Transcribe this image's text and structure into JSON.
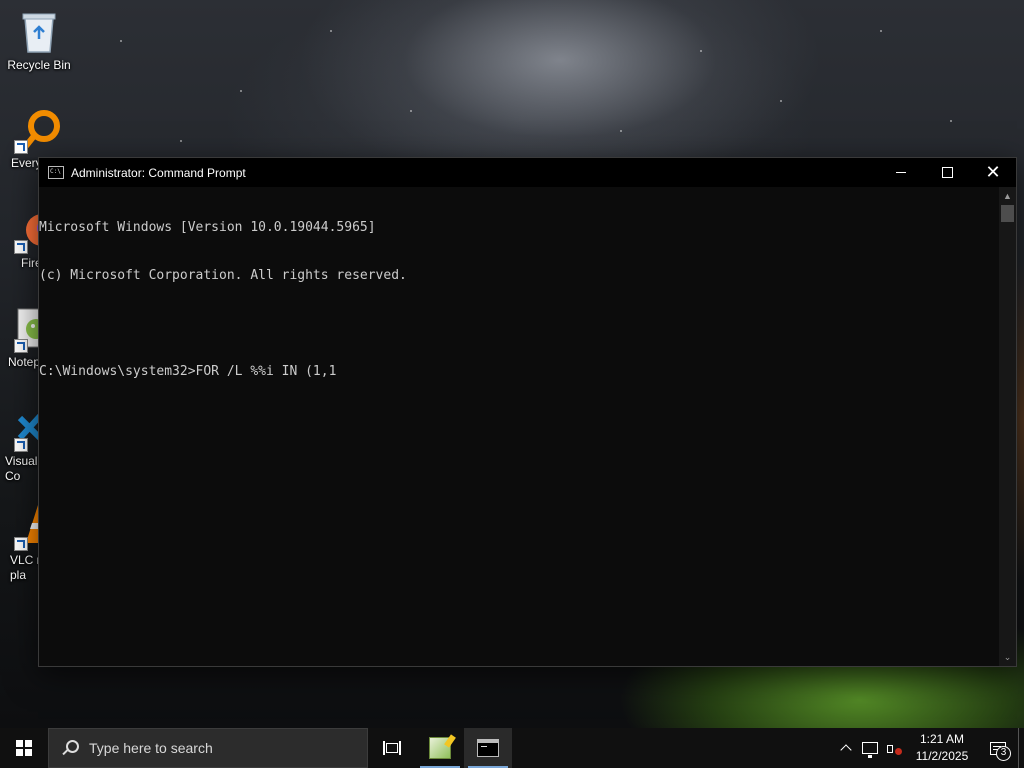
{
  "desktop": {
    "icons": [
      {
        "label": "Recycle Bin",
        "icon": "recycle-bin-icon"
      },
      {
        "label": "Every",
        "icon": "everything-search-icon"
      },
      {
        "label": "Fire",
        "icon": "firefox-icon"
      },
      {
        "label": "Notep",
        "icon": "notepad-plus-plus-icon"
      },
      {
        "label": "Visual\nCo",
        "icon": "vscode-icon"
      },
      {
        "label": "VLC r\npla",
        "icon": "vlc-icon"
      }
    ]
  },
  "window": {
    "title": "Administrator: Command Prompt",
    "buttons": {
      "minimize": "minimize",
      "maximize": "maximize",
      "close": "✕"
    },
    "console_lines": [
      "Microsoft Windows [Version 10.0.19044.5965]",
      "(c) Microsoft Corporation. All rights reserved.",
      "",
      "C:\\Windows\\system32>FOR /L %%i IN (1,1"
    ],
    "scrollbar": {
      "up": "▲",
      "down": "⌄"
    }
  },
  "taskbar": {
    "search_placeholder": "Type here to search",
    "apps": [
      {
        "name": "task-view"
      },
      {
        "name": "notepad-plus-plus"
      },
      {
        "name": "command-prompt"
      }
    ],
    "clock": {
      "time": "1:21 AM",
      "date": "11/2/2025"
    },
    "notification_count": "3"
  }
}
